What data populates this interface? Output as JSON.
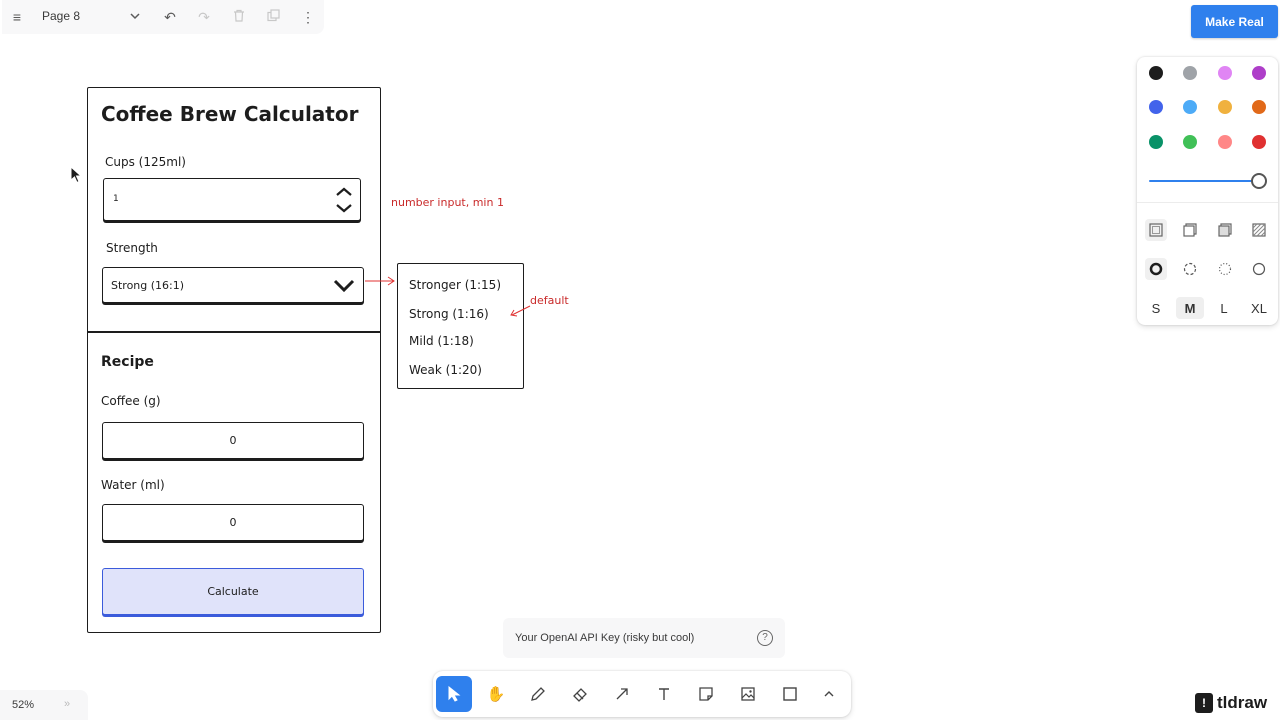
{
  "topbar": {
    "menu_icon": "hamburger-icon",
    "page_name": "Page 8",
    "icons": [
      "chevron-down-icon",
      "undo-icon",
      "redo-icon",
      "trash-icon",
      "duplicate-icon",
      "more-vertical-icon"
    ]
  },
  "make_real": {
    "label": "Make Real",
    "color": "#2f80ed"
  },
  "style_panel": {
    "colors": [
      "#1d1d1d",
      "#9fa3a8",
      "#e085f4",
      "#ae3ec9",
      "#4263eb",
      "#4dabf7",
      "#f0b13e",
      "#e16919",
      "#099268",
      "#40c057",
      "#ff8787",
      "#e03131"
    ],
    "opacity": 1,
    "fill_icons": [
      "fill-none-icon",
      "fill-semi-icon",
      "fill-solid-icon",
      "fill-pattern-icon"
    ],
    "dash_icons": [
      "dash-draw-icon",
      "dash-dashed-icon",
      "dash-dotted-icon",
      "dash-solid-icon"
    ],
    "sizes": [
      "S",
      "M",
      "L",
      "XL"
    ],
    "selected_size": "M"
  },
  "wireframe": {
    "title": "Coffee Brew Calculator",
    "cups_label": "Cups (125ml)",
    "cups_value": "1",
    "strength_label": "Strength",
    "strength_value": "Strong (16:1)",
    "recipe_heading": "Recipe",
    "coffee_label": "Coffee (g)",
    "coffee_value": "0",
    "water_label": "Water (ml)",
    "water_value": "0",
    "calculate_label": "Calculate",
    "dropdown_options": [
      "Stronger (1:15)",
      "Strong (1:16)",
      "Mild (1:18)",
      "Weak (1:20)"
    ],
    "notes": {
      "number_input": "number input, min 1",
      "default": "default"
    }
  },
  "api_key": {
    "placeholder": "Your OpenAI API Key (risky but cool)"
  },
  "toolbar": {
    "tools": [
      "select-icon",
      "hand-icon",
      "draw-icon",
      "eraser-icon",
      "arrow-icon",
      "text-icon",
      "note-icon",
      "image-icon",
      "rectangle-icon",
      "chevron-up-icon"
    ],
    "active_tool": "select-icon"
  },
  "zoom": {
    "level": "52%"
  },
  "logo": {
    "text": "tldraw"
  }
}
